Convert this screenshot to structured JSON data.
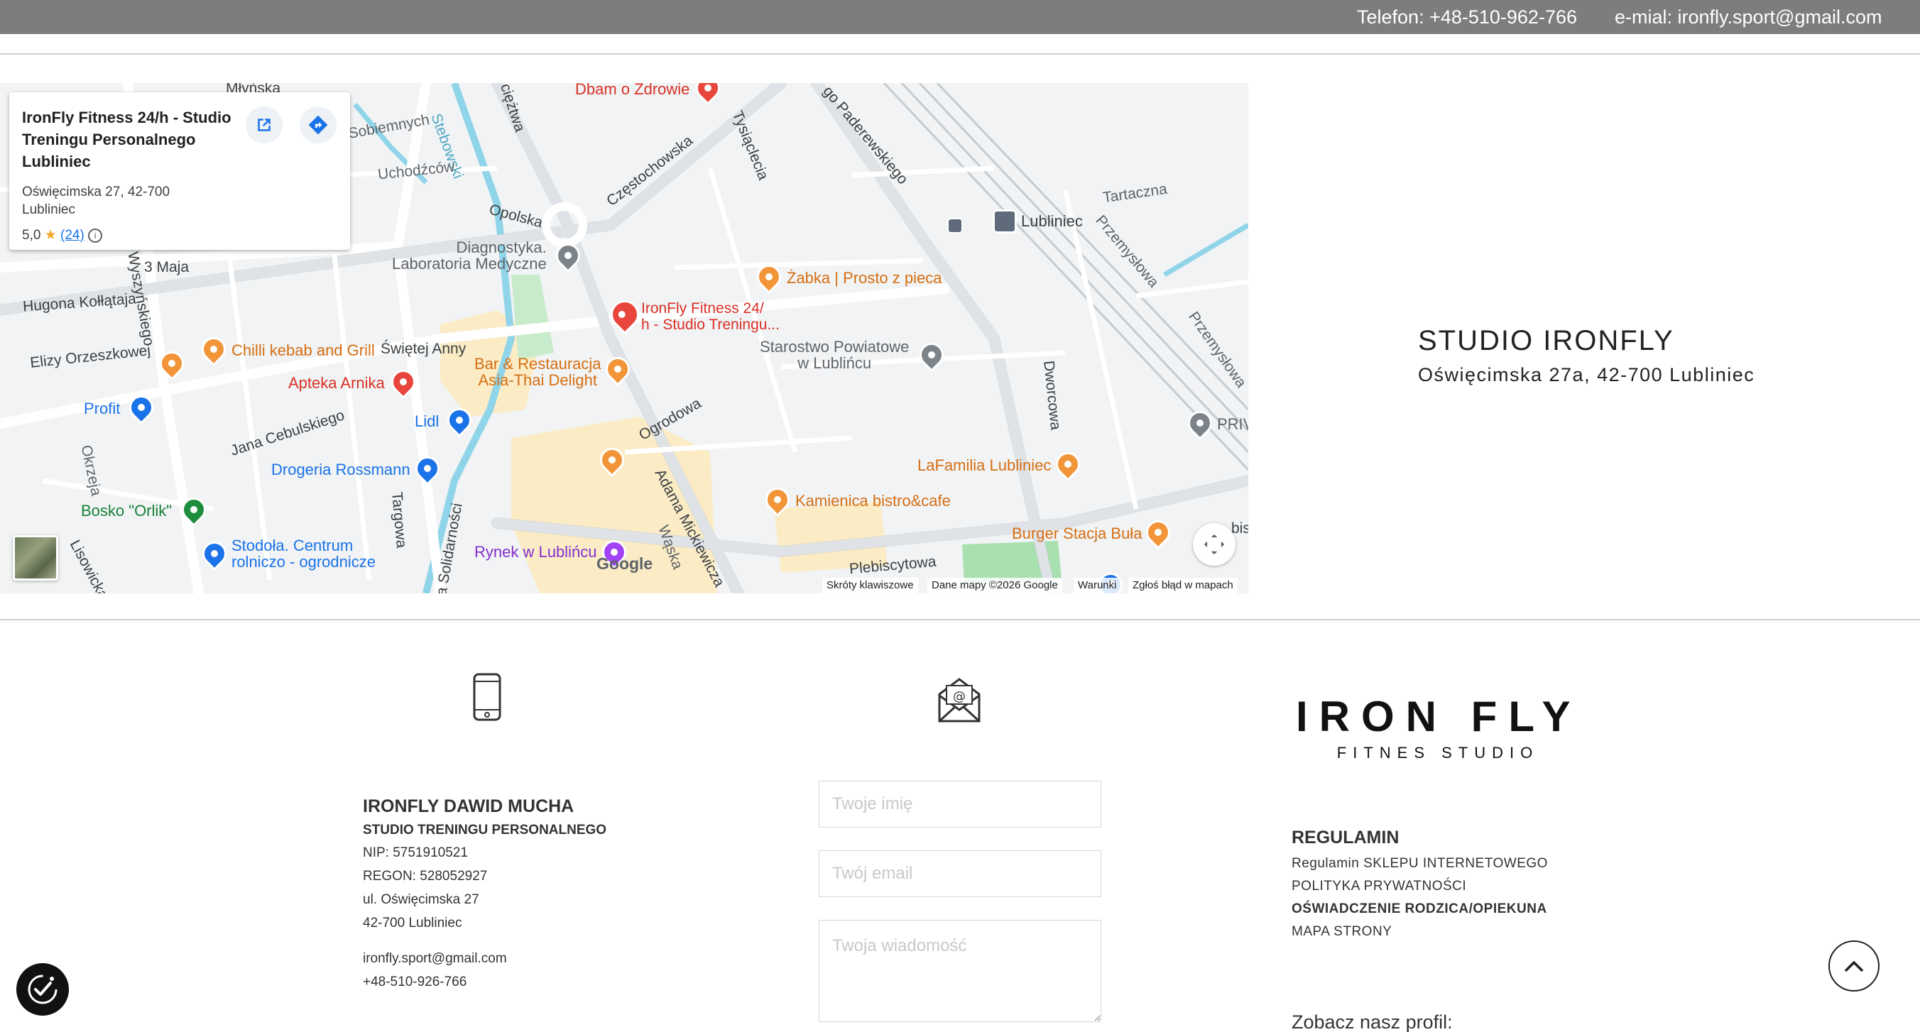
{
  "topbar": {
    "phone": "Telefon: +48-510-962-766",
    "email": "e-mial: ironfly.sport@gmail.com"
  },
  "map": {
    "card": {
      "name": "IronFly Fitness 24/h - Studio Treningu Personalnego Lubliniec",
      "address": "Oświęcimska 27, 42-700 Lubliniec",
      "rating": "5,0",
      "star": "★",
      "reviews": "(24)"
    },
    "streets": {
      "mlynska": "Młyńska",
      "stebowski": "Stebowski",
      "ciesztwa": "ciężtwa",
      "sobiemnych": "Sobiemnych",
      "uchodzcow": "Uchodźców",
      "opolska": "Opolska",
      "czestochowska": "Częstochowska",
      "tysiaclecia": "Tysiąclecia",
      "paderewskiego": "go Paderewskiego",
      "tartaczna": "Tartaczna",
      "przemyslowa1": "Przemysłowa",
      "przemyslowa2": "Przemysłowa",
      "wyszynskiego": "Wyszyńskiego",
      "maja": "3 Maja",
      "hugona": "Hugona Kołłątaja",
      "swietej_anny": "Świętej Anny",
      "elizy": "Elizy Orzeszkowej",
      "ogrodowa": "Ogrodowa",
      "dworcowa": "Dworcowa",
      "cebulskiego": "Jana Cebulskiego",
      "okrzeja": "Okrzeja",
      "targowa": "Targowa",
      "solidarnosci": "a Solidarności",
      "mickiewicza": "Adama Mickiewicza",
      "waska": "Wąska",
      "plebiscytowa": "Plebiscytowa",
      "lisowicka": "Lisowicka",
      "bis": "bis"
    },
    "pois": {
      "dbam": "Dbam o Zdrowie",
      "diagnostyka": "Diagnostyka.\nLaboratoria Medyczne",
      "lubliniec_station": "Lubliniec",
      "zabka": "Żabka | Prosto z pieca",
      "ironfly": "IronFly Fitness 24/\nh - Studio Treningu...",
      "starostwo": "Starostwo Powiatowe\nw Lublińcu",
      "chilli": "Chilli kebab and Grill",
      "bar": "Bar & Restauracja\nAsia-Thai Delight",
      "apteka": "Apteka Arnika",
      "profit": "Profit",
      "lidl": "Lidl",
      "priv": "PRIV",
      "rossmann": "Drogeria Rossmann",
      "lafamilia": "LaFamilia Lubliniec",
      "kamienica": "Kamienica bistro&cafe",
      "orlik": "Bosko \"Orlik\"",
      "stodola": "Stodoła. Centrum\nrolniczo - ogrodnicze",
      "rynek": "Rynek w Lublińcu",
      "burger": "Burger Stacja Buła"
    },
    "google": "Google",
    "attribution": {
      "shortcuts": "Skróty klawiszowe",
      "data": "Dane mapy ©2026 Google",
      "terms": "Warunki",
      "report": "Zgłoś błąd w mapach"
    }
  },
  "studio": {
    "title": "STUDIO IRONFLY",
    "address": "Oświęcimska 27a, 42-700 Lubliniec"
  },
  "company": {
    "name": "IRONFLY DAWID MUCHA",
    "subtitle": "STUDIO TRENINGU PERSONALNEGO",
    "nip": "NIP: 5751910521",
    "regon": "REGON: 528052927",
    "street": "ul. Oświęcimska 27",
    "city": "42-700 Lubliniec",
    "email": "ironfly.sport@gmail.com",
    "phone": "+48-510-926-766"
  },
  "form": {
    "name_placeholder": "Twoje imię",
    "email_placeholder": "Twój email",
    "message_placeholder": "Twoja wiadomość"
  },
  "logo": {
    "main": "IRON FLY",
    "sub": "FITNES STUDIO"
  },
  "links": {
    "heading": "REGULAMIN",
    "items": [
      "Regulamin SKLEPU INTERNETOWEGO",
      "POLITYKA PRYWATNOŚCI",
      "OŚWIADCZENIE RODZICA/OPIEKUNA",
      "MAPA STRONY"
    ],
    "profile": "Zobacz nasz profil:"
  },
  "colors": {
    "topbar": "#7d7d7d",
    "poi_orange": "#f29539",
    "poi_blue": "#1a73e8",
    "pin_red": "#e8453c"
  }
}
